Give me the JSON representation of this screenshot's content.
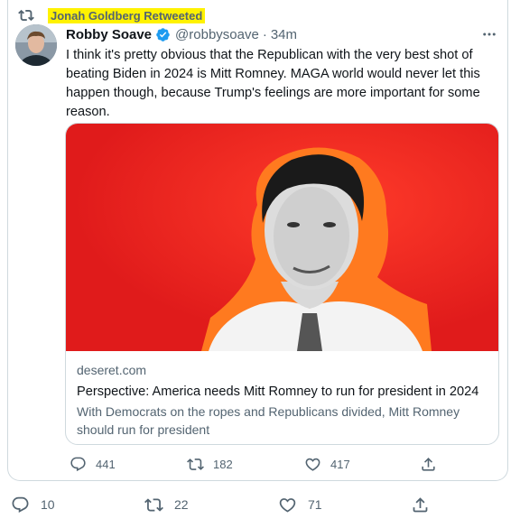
{
  "retweet": {
    "label": "Jonah Goldberg Retweeted",
    "icon": "retweet-icon"
  },
  "tweet": {
    "author_name": "Robby Soave",
    "handle": "@robbysoave",
    "separator": "·",
    "time": "34m",
    "more_icon": "ellipsis-icon",
    "text": "I think it's pretty obvious that the Republican with the very best shot of beating Biden in 2024 is Mitt Romney. MAGA world would never let this happen though, because Trump's feelings are more important for some reason."
  },
  "link_card": {
    "domain": "deseret.com",
    "title": "Perspective: America needs Mitt Romney to run for president in 2024",
    "description": "With Democrats on the ropes and Republicans divided, Mitt Romney should run for president"
  },
  "inner_actions": {
    "replies": "441",
    "retweets": "182",
    "likes": "417"
  },
  "outer_actions": {
    "replies": "10",
    "retweets": "22",
    "likes": "71"
  },
  "colors": {
    "accent": "#1d9bf0",
    "secondary_text": "#536471",
    "highlight": "#fff200",
    "image_bg": "#e5201f",
    "image_glow": "#ff6a1a"
  }
}
